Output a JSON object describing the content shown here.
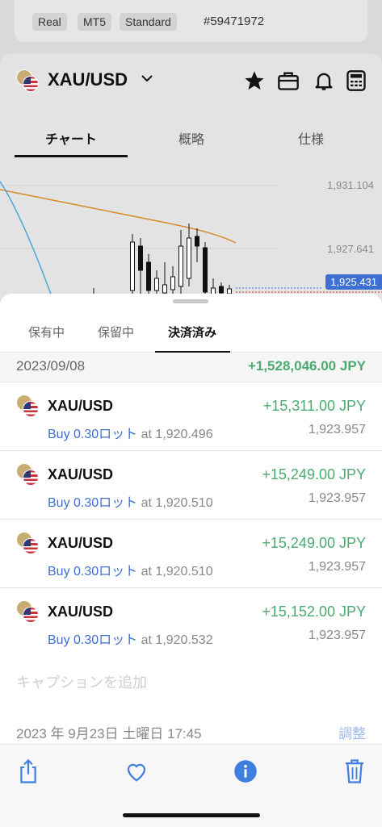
{
  "account": {
    "badges": [
      "Real",
      "MT5",
      "Standard"
    ],
    "number": "#59471972"
  },
  "symbol": {
    "name": "XAU/USD",
    "tabs": [
      "チャート",
      "概略",
      "仕様"
    ]
  },
  "chart": {
    "price_levels": [
      "1,931.104",
      "1,927.641"
    ],
    "current_price": "1,925.431"
  },
  "sheet": {
    "tabs": [
      "保有中",
      "保留中",
      "決済済み"
    ],
    "date": "2023/09/08",
    "total": "+1,528,046.00 JPY",
    "rows": [
      {
        "symbol": "XAU/USD",
        "profit": "+15,311.00 JPY",
        "side": "Buy 0.30ロット",
        "at": "at 1,920.496",
        "close": "1,923.957"
      },
      {
        "symbol": "XAU/USD",
        "profit": "+15,249.00 JPY",
        "side": "Buy 0.30ロット",
        "at": "at 1,920.510",
        "close": "1,923.957"
      },
      {
        "symbol": "XAU/USD",
        "profit": "+15,249.00 JPY",
        "side": "Buy 0.30ロット",
        "at": "at 1,920.510",
        "close": "1,923.957"
      },
      {
        "symbol": "XAU/USD",
        "profit": "+15,152.00 JPY",
        "side": "Buy 0.30ロット",
        "at": "at 1,920.532",
        "close": "1,923.957"
      }
    ]
  },
  "photos": {
    "caption_placeholder": "キャプションを追加",
    "timestamp": "2023 年 9月23日 土曜日 17:45",
    "adjust_label": "調整"
  },
  "colors": {
    "profit_green": "#4caa70",
    "accent_blue": "#3e6fd2",
    "ma_orange": "#d98a2b",
    "ma_blue": "#4aa7d8"
  }
}
